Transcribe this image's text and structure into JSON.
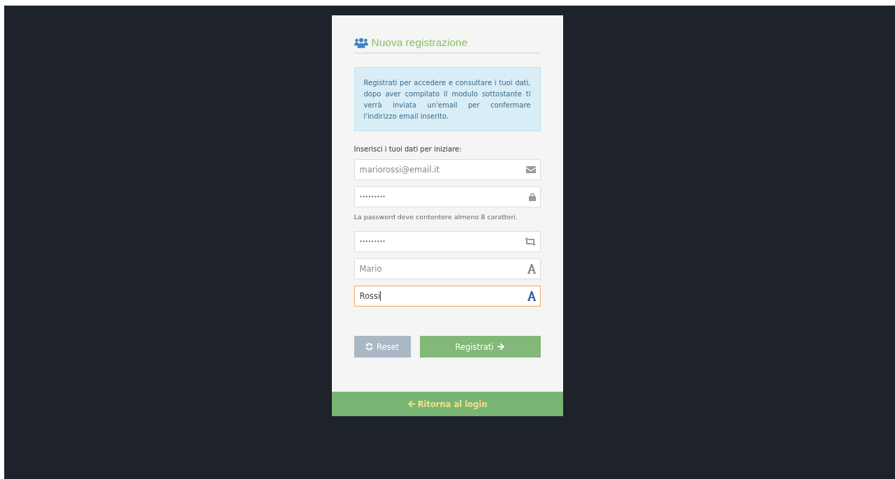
{
  "form": {
    "title": "Nuova registrazione",
    "info": "Registrati per accedere e consultare i tuoi dati, dopo aver compilato il modulo sottostante ti verrà inviata un'email per confermare l'indirizzo email inserito.",
    "prompt": "Inserisci i tuoi dati per iniziare:",
    "fields": [
      {
        "kind": "email",
        "placeholder": "mariorossi@email.it",
        "focused": false
      },
      {
        "kind": "password",
        "value": "•••••••••",
        "focused": false,
        "help": "La password deve contentere almeno 8 caratteri."
      },
      {
        "kind": "repeat",
        "value": "•••••••••",
        "focused": false
      },
      {
        "kind": "text",
        "placeholder": "Mario",
        "focused": false
      },
      {
        "kind": "text",
        "value": "Rossi",
        "focused": true
      }
    ],
    "buttons": [
      {
        "kind": "reset",
        "label": "Reset"
      },
      {
        "kind": "submit",
        "label": "Registrati"
      }
    ]
  },
  "footer_link": "Ritorna al login"
}
